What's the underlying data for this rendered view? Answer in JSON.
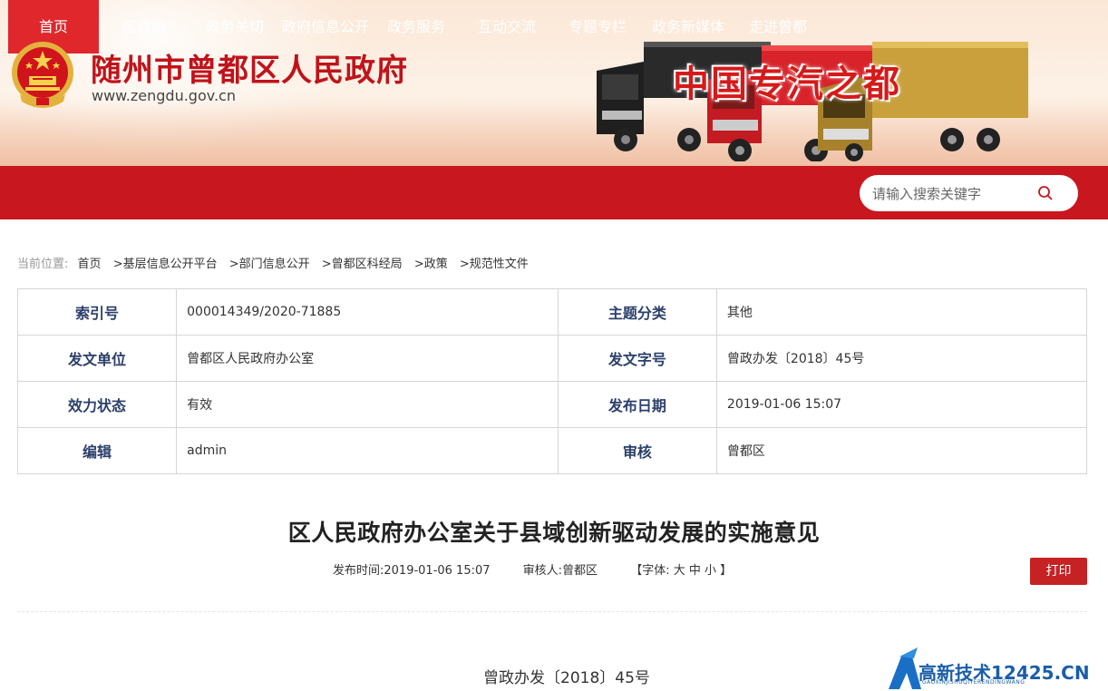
{
  "header": {
    "site_title": "随州市曾都区人民政府",
    "site_url": "www.zengdu.gov.cn",
    "slogan": "中国专汽之都"
  },
  "nav": {
    "items": [
      {
        "label": "首页"
      },
      {
        "label": "区政府"
      },
      {
        "label": "政务关切"
      },
      {
        "label": "政府信息公开"
      },
      {
        "label": "政务服务"
      },
      {
        "label": "互动交流"
      },
      {
        "label": "专题专栏"
      },
      {
        "label": "政务新媒体"
      },
      {
        "label": "走进曾都"
      }
    ],
    "active_index": 0,
    "search_placeholder": "请输入搜索关键字",
    "colors": {
      "bar": "#c8171e",
      "active": "#e0272b"
    }
  },
  "breadcrumb": {
    "lead": "当前位置:",
    "items": [
      "首页",
      ">基层信息公开平台",
      ">部门信息公开",
      ">曾都区科经局",
      ">政策",
      ">规范性文件"
    ]
  },
  "info": {
    "index_no_label": "索引号",
    "index_no": "000014349/2020-71885",
    "topic_label": "主题分类",
    "topic": "其他",
    "issuer_label": "发文单位",
    "issuer": "曾都区人民政府办公室",
    "doc_code_label": "发文字号",
    "doc_code": "曾政办发〔2018〕45号",
    "status_label": "效力状态",
    "status": "有效",
    "pub_date_label": "发布日期",
    "pub_date": "2019-01-06 15:07",
    "editor_label": "编辑",
    "editor": "admin",
    "reviewer_label": "审核",
    "reviewer": "曾都区"
  },
  "article": {
    "title": "区人民政府办公室关于县域创新驱动发展的实施意见",
    "publish_time": "发布时间:2019-01-06 15:07",
    "reviewer": "审核人:曾都区",
    "font_size": "【字体: 大 中 小 】",
    "print_label": "打印",
    "doc_no": "曾政办发〔2018〕45号"
  },
  "watermark": {
    "text": "高新技术12425.CN",
    "sub": "GAOXINJISHUQIYERENDINGWANG"
  }
}
